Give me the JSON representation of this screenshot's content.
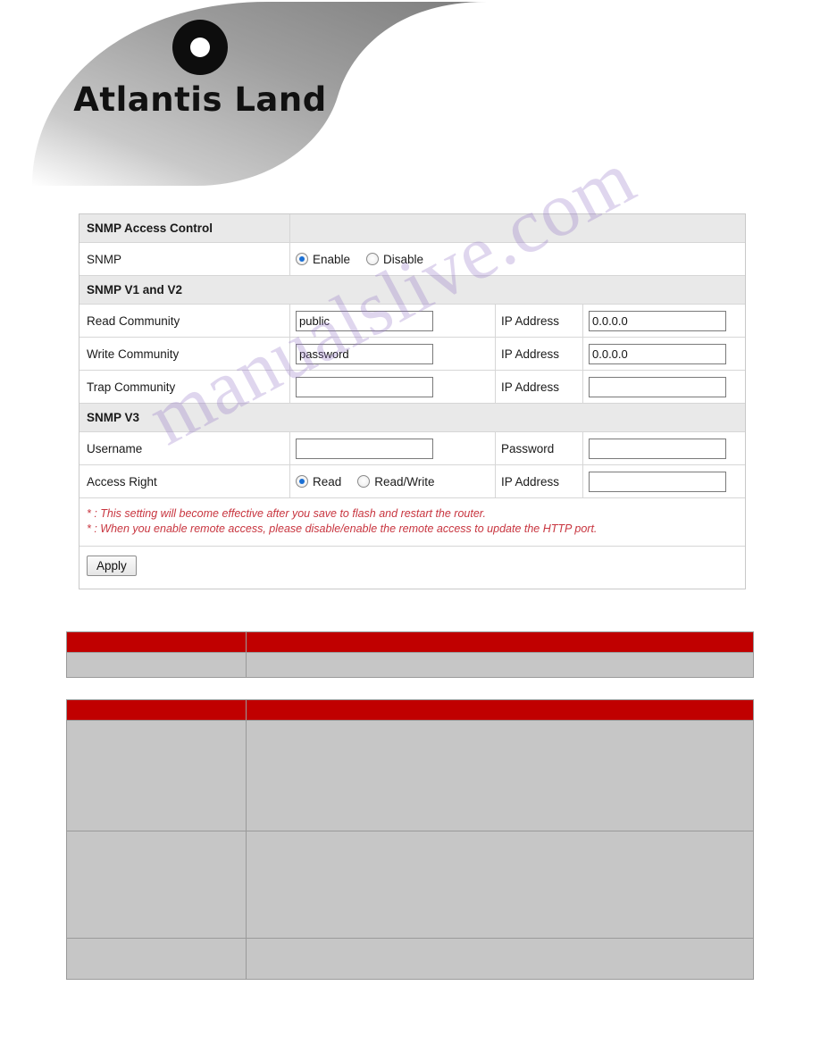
{
  "brand": {
    "name": "Atlantis Land",
    "logo_icon": "circle-dot-icon"
  },
  "watermark": "manualslive.com",
  "panel": {
    "section_access_control": "SNMP Access Control",
    "snmp_label": "SNMP",
    "snmp_options": [
      {
        "label": "Enable",
        "selected": true
      },
      {
        "label": "Disable",
        "selected": false
      }
    ],
    "section_v1v2": "SNMP V1 and V2",
    "rows_v1v2": [
      {
        "label": "Read Community",
        "value": "public",
        "ip_label": "IP Address",
        "ip_value": "0.0.0.0"
      },
      {
        "label": "Write Community",
        "value": "password",
        "ip_label": "IP Address",
        "ip_value": "0.0.0.0"
      },
      {
        "label": "Trap Community",
        "value": "",
        "ip_label": "IP Address",
        "ip_value": ""
      }
    ],
    "section_v3": "SNMP V3",
    "username_label": "Username",
    "username_value": "",
    "password_label": "Password",
    "password_value": "",
    "access_right_label": "Access Right",
    "access_right_options": [
      {
        "label": "Read",
        "selected": true
      },
      {
        "label": "Read/Write",
        "selected": false
      }
    ],
    "access_ip_label": "IP Address",
    "access_ip_value": "",
    "note1": "* : This setting will become effective after you save to flash and restart the router.",
    "note2": "* : When you enable remote access, please disable/enable the remote access to update the HTTP port.",
    "apply_label": "Apply"
  },
  "tables": [
    {
      "header": [
        "",
        ""
      ],
      "rows": [
        [
          "",
          ""
        ]
      ]
    },
    {
      "header": [
        "",
        ""
      ],
      "rows": [
        [
          "",
          ""
        ],
        [
          "",
          ""
        ],
        [
          "",
          ""
        ]
      ]
    }
  ],
  "colors": {
    "table_header": "#c00000",
    "table_body": "#c6c6c6",
    "note_text": "#c8353f",
    "section_bg": "#e9e9e9",
    "radio_accent": "#1a6fd4"
  }
}
